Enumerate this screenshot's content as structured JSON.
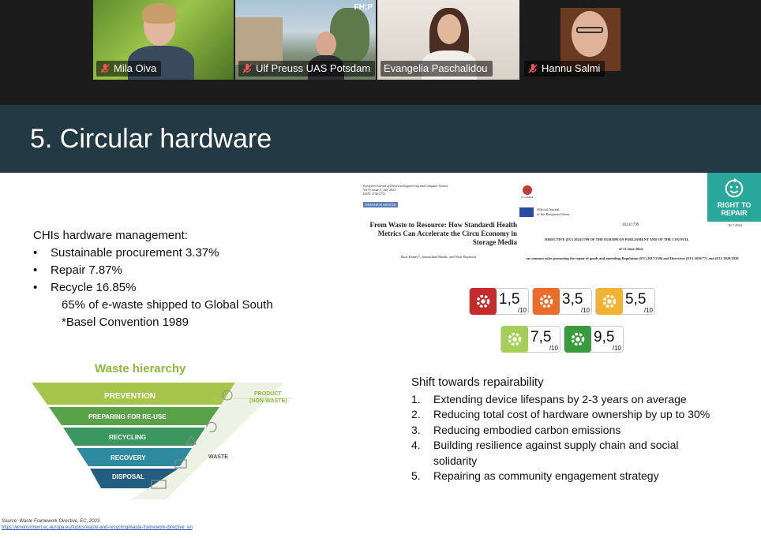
{
  "participants": [
    {
      "name": "Mila Oiva",
      "muted": true
    },
    {
      "name": "Ulf Preuss UAS Potsdam",
      "muted": true,
      "badge": "FH;P"
    },
    {
      "name": "Evangelia Paschalidou",
      "muted": false,
      "active": true
    },
    {
      "name": "Hannu Salmi",
      "muted": true
    }
  ],
  "slide": {
    "title": "5. Circular hardware",
    "right_to_repair": "RIGHT TO REPAIR",
    "management": {
      "heading": "CHIs hardware management:",
      "items": [
        {
          "label": "Sustainable procurement",
          "value": "3.37%"
        },
        {
          "label": "Repair",
          "value": "7.87%"
        },
        {
          "label": "Recycle",
          "value": "16.85%"
        }
      ],
      "sub_value": "65%",
      "sub_text": "of e-waste shipped to Global South",
      "note": "*Basel Convention 1989"
    },
    "waste_hierarchy": {
      "title": "Waste hierarchy",
      "levels": [
        "PREVENTION",
        "PREPARING FOR RE-USE",
        "RECYCLING",
        "RECOVERY",
        "DISPOSAL"
      ],
      "product_label": "PRODUCT",
      "product_sub": "(NON-WASTE)",
      "waste_label": "WASTE"
    },
    "paper": {
      "journal": "European Journal of Electrical Engineering and Computer Science",
      "volume": "Vol 8 | Issue 3 | July 2024",
      "issn": "ISSN: 2736-5751",
      "tag": "RESEARCH ARTICLE",
      "title": "From Waste to Resource: How Standardi Health Metrics Can Accelerate the Circu Economy in Storage Media",
      "authors": "Rich Kenny*, Jonnachael Hands, and Nick Hayhurst"
    },
    "directive": {
      "publisher": "CrossMark",
      "oj_line1": "Official Journal",
      "oj_line2": "of the European Union",
      "code": "2024/1799",
      "date": "10.7.2024",
      "title": "DIRECTIVE (EU) 2024/1799 OF THE EUROPEAN PARLIAMENT AND OF THE COUNCIL",
      "of_date": "of 13 June 2024",
      "subtitle": "on common rules promoting the repair of goods and amending Regulation (EU) 2017/2394 and Directives (EU) 2019/771 and (EU) 2020/1828"
    },
    "scores": [
      {
        "value": "1,5",
        "denom": "/10",
        "color": "#c42b2b"
      },
      {
        "value": "3,5",
        "denom": "/10",
        "color": "#ec6d2b"
      },
      {
        "value": "5,5",
        "denom": "/10",
        "color": "#f2b233"
      },
      {
        "value": "7,5",
        "denom": "/10",
        "color": "#a6cf5a"
      },
      {
        "value": "9,5",
        "denom": "/10",
        "color": "#3a9a3e"
      }
    ],
    "shift": {
      "heading": "Shift towards repairability",
      "items": [
        {
          "num": "1.",
          "text": "Extending device lifespans by 2-3 years on average"
        },
        {
          "num": "2.",
          "text": "Reducing total cost of hardware ownership by up to 30%"
        },
        {
          "num": "3.",
          "text": "Reducing embodied carbon emissions"
        },
        {
          "num": "4.",
          "text": "Building resilience against supply chain and social solidarity"
        },
        {
          "num": "5.",
          "text": "Repairing as community engagement strategy"
        }
      ]
    },
    "source": {
      "text": "Source: Waste Framework Directive, EC, 2023",
      "url": "https://environment.ec.europa.eu/topics/waste-and-recycling/waste-framework-directive_en"
    }
  },
  "colors": {
    "header": "#233a44",
    "accent_green": "#8cb83a",
    "teal": "#2aa79b",
    "active_border": "#4fd16b"
  }
}
